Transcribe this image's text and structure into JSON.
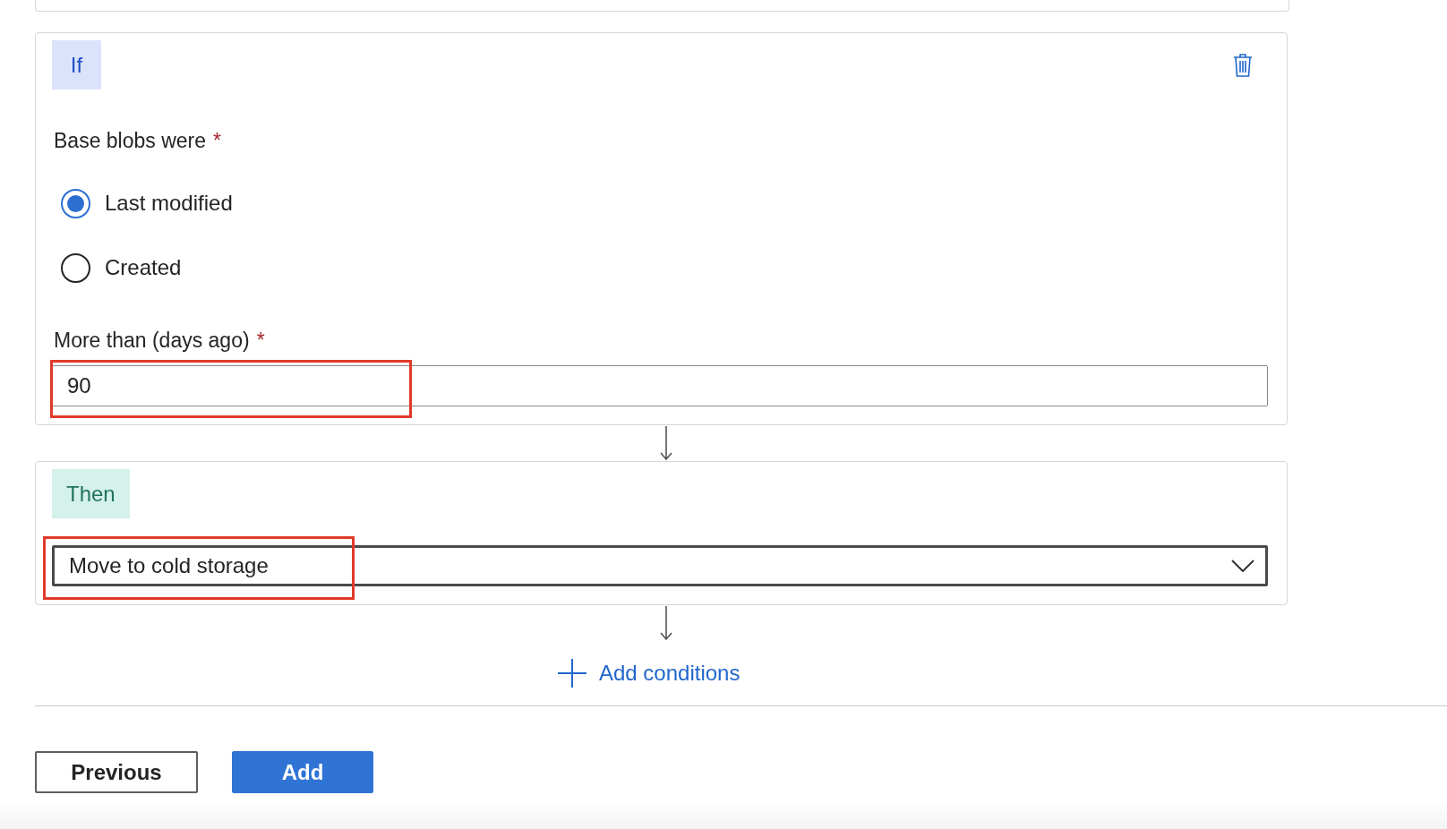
{
  "if_card": {
    "badge": "If",
    "group": {
      "label": "Base blobs were",
      "required_mark": "*",
      "options": [
        {
          "label": "Last modified",
          "selected": true
        },
        {
          "label": "Created",
          "selected": false
        }
      ]
    },
    "days_field": {
      "label": "More than (days ago)",
      "required_mark": "*",
      "value": "90",
      "highlighted": true
    }
  },
  "then_card": {
    "badge": "Then",
    "action_select": {
      "value": "Move to cold storage",
      "highlighted": true
    }
  },
  "add_conditions": "Add conditions",
  "buttons": [
    {
      "label": "Previous",
      "kind": "secondary"
    },
    {
      "label": "Add",
      "kind": "primary"
    }
  ]
}
